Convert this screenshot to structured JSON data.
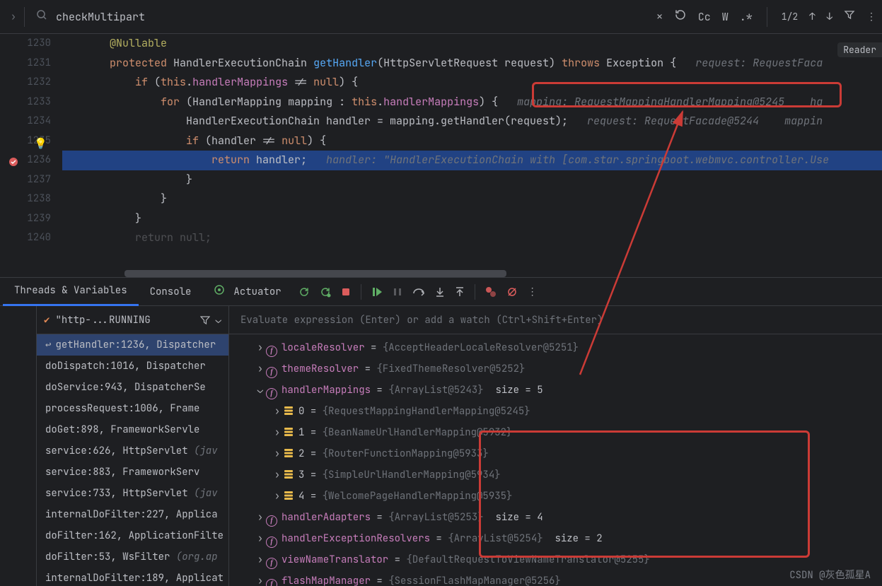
{
  "search": {
    "value": "checkMultipart",
    "match_count": "1/2",
    "cc": "Cc",
    "w": "W",
    "regex": ".*"
  },
  "reader_label": "Reader",
  "lines": [
    "1230",
    "1231",
    "1232",
    "1233",
    "1234",
    "1235",
    "1236",
    "1237",
    "1238",
    "1239",
    "1240"
  ],
  "code": {
    "anno": "@Nullable",
    "kw_protected": "protected",
    "type_hec": "HandlerExecutionChain",
    "m_getHandler": "getHandler",
    "sig_params": "(HttpServletRequest request)",
    "kw_throws": "throws",
    "type_exc": "Exception",
    "hint_req1": "request: RequestFaca",
    "kw_if": "if",
    "kw_this": "this",
    "field_hm": "handlerMappings",
    "kw_null": "null",
    "kw_for": "for",
    "type_hm": "HandlerMapping",
    "var_mapping": "mapping",
    "hint_mapping": "mapping: RequestMappingHandlerMapping@5245",
    "hint_han_trail": "ha",
    "line_handler": "HandlerExecutionChain handler = mapping.getHandler(request);",
    "hint_req2": "request: RequestFacade@5244",
    "hint_mapping2": "mappin",
    "line_if_handler": "(handler != ",
    "kw_return": "return",
    "var_handler": "handler",
    "hint_handler": "handler: \"HandlerExecutionChain with [com.star.springboot.webmvc.controller.Use"
  },
  "tabs": {
    "threads": "Threads & Variables",
    "console": "Console",
    "actuator": "Actuator"
  },
  "thread_name": "\"http-...RUNNING",
  "frames": [
    {
      "txt": "getHandler:1236, Dispatcher",
      "sel": true,
      "undo": true
    },
    {
      "txt": "doDispatch:1016, Dispatcher"
    },
    {
      "txt": "doService:943, DispatcherSe"
    },
    {
      "txt": "processRequest:1006, Frame"
    },
    {
      "txt": "doGet:898, FrameworkServle"
    },
    {
      "txt": "service:626, HttpServlet ",
      "dim": "(jav"
    },
    {
      "txt": "service:883, FrameworkServ"
    },
    {
      "txt": "service:733, HttpServlet ",
      "dim": "(jav"
    },
    {
      "txt": "internalDoFilter:227, Applica"
    },
    {
      "txt": "doFilter:162, ApplicationFilte"
    },
    {
      "txt": "doFilter:53, WsFilter ",
      "dim": "(org.ap"
    },
    {
      "txt": "internalDoFilter:189, Applicat"
    }
  ],
  "eval_placeholder": "Evaluate expression (Enter) or add a watch (Ctrl+Shift+Enter)",
  "vars": {
    "localeResolver": {
      "name": "localeResolver",
      "val": "{AcceptHeaderLocaleResolver@5251}"
    },
    "themeResolver": {
      "name": "themeResolver",
      "val": "{FixedThemeResolver@5252}"
    },
    "handlerMappings": {
      "name": "handlerMappings",
      "val": "{ArrayList@5243}",
      "size": "size = 5"
    },
    "hm_items": [
      {
        "idx": "0",
        "val": "{RequestMappingHandlerMapping@5245}"
      },
      {
        "idx": "1",
        "val": "{BeanNameUrlHandlerMapping@5932}"
      },
      {
        "idx": "2",
        "val": "{RouterFunctionMapping@5933}"
      },
      {
        "idx": "3",
        "val": "{SimpleUrlHandlerMapping@5934}"
      },
      {
        "idx": "4",
        "val": "{WelcomePageHandlerMapping@5935}"
      }
    ],
    "handlerAdapters": {
      "name": "handlerAdapters",
      "val": "{ArrayList@5253}",
      "size": "size = 4"
    },
    "handlerExceptionResolvers": {
      "name": "handlerExceptionResolvers",
      "val": "{ArrayList@5254}",
      "size": "size = 2"
    },
    "viewNameTranslator": {
      "name": "viewNameTranslator",
      "val": "{DefaultRequestToViewNameTranslator@5255}"
    },
    "flashMapManager": {
      "name": "flashMapManager",
      "val": "{SessionFlashMapManager@5256}"
    }
  },
  "watermark": "CSDN @灰色孤星A"
}
